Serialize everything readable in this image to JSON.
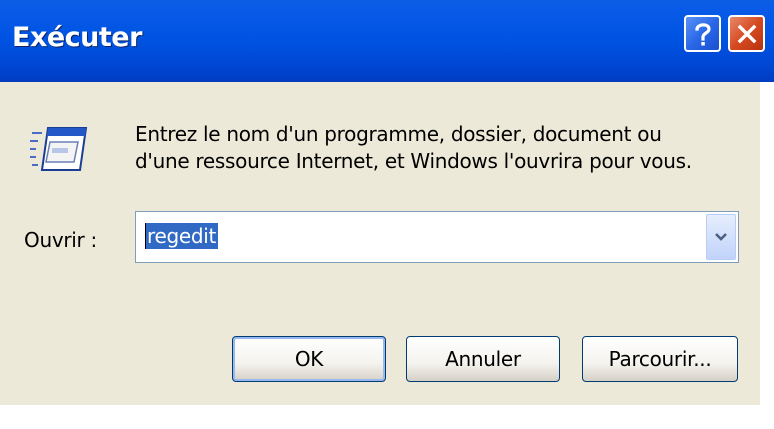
{
  "window": {
    "title": "Exécuter"
  },
  "titlebar_buttons": {
    "help_icon": "question-mark",
    "close_icon": "x"
  },
  "prompt": {
    "icon": "run-icon",
    "line1": "Entrez le nom d'un programme, dossier, document ou",
    "line2": "d'une ressource Internet, et Windows l'ouvrira pour vous."
  },
  "open_field": {
    "label": "Ouvrir :",
    "value": "regedit",
    "dropdown_icon": "chevron-down"
  },
  "buttons": {
    "ok": "OK",
    "cancel": "Annuler",
    "browse": "Parcourir..."
  },
  "colors": {
    "titlebar": "#0054e3",
    "dialog_bg": "#ece9d8",
    "selection": "#316ac5",
    "close_button": "#d64a21"
  }
}
